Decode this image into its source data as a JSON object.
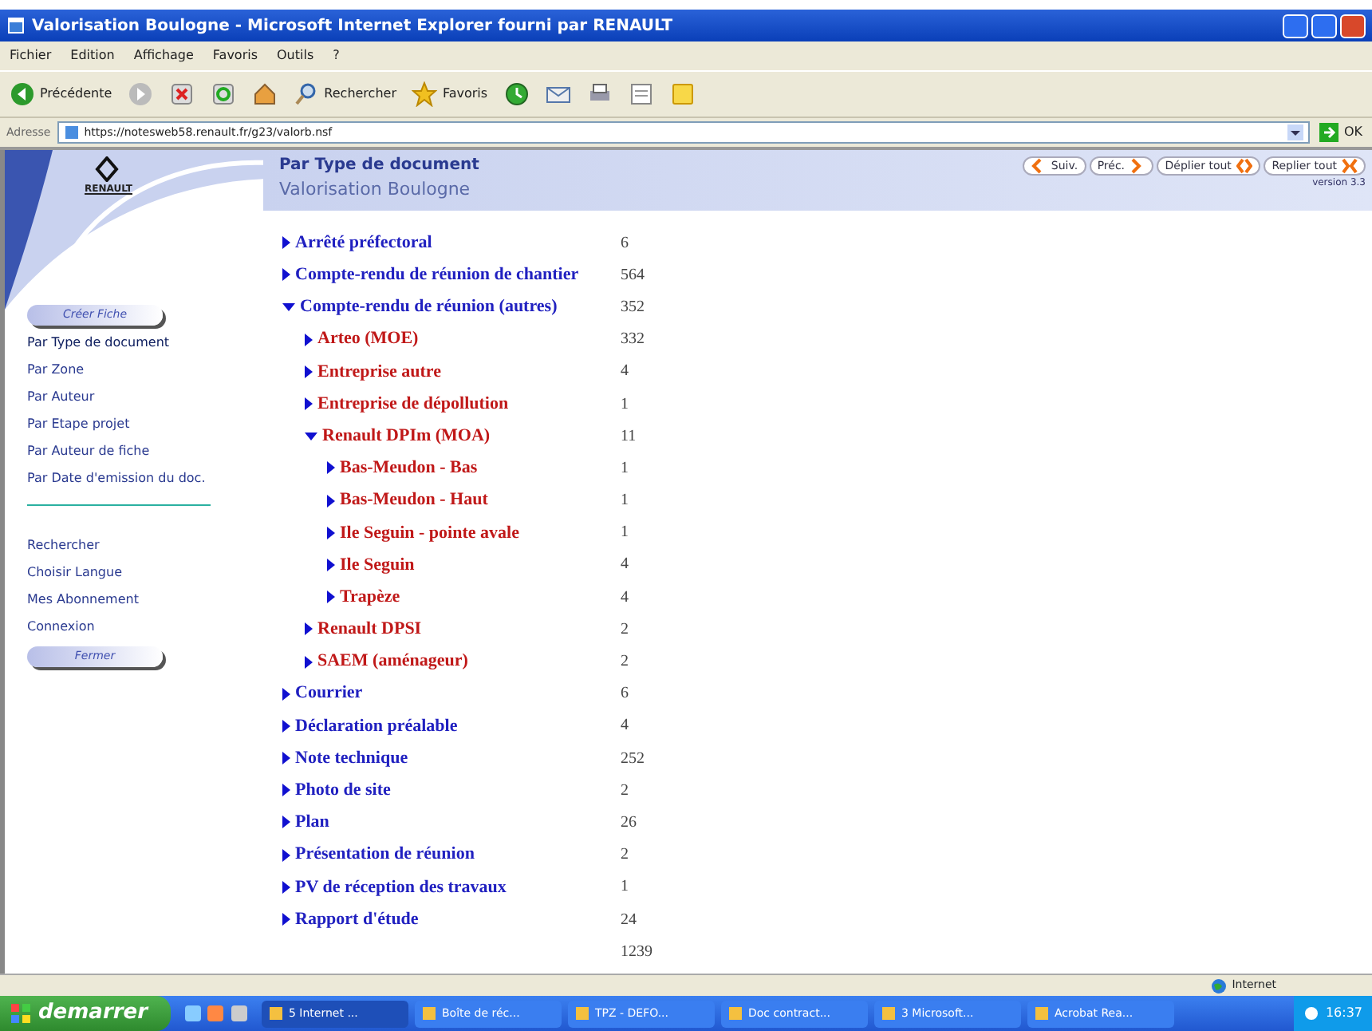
{
  "window": {
    "title": "Valorisation Boulogne - Microsoft Internet Explorer fourni par RENAULT"
  },
  "menu": [
    "Fichier",
    "Edition",
    "Affichage",
    "Favoris",
    "Outils",
    "?"
  ],
  "toolbar": [
    {
      "kind": "back",
      "label": "Précédente"
    },
    {
      "kind": "forward"
    },
    {
      "kind": "stop"
    },
    {
      "kind": "refresh"
    },
    {
      "kind": "home"
    },
    {
      "kind": "search",
      "label": "Rechercher"
    },
    {
      "kind": "favorites",
      "label": "Favoris"
    },
    {
      "kind": "history"
    },
    {
      "kind": "mail"
    },
    {
      "kind": "print"
    },
    {
      "kind": "edit"
    },
    {
      "kind": "note"
    }
  ],
  "address": {
    "label": "Adresse",
    "value": "https://notesweb58.renault.fr/g23/valorb.nsf",
    "go": "OK"
  },
  "sidebar": {
    "logo": "RENAULT",
    "create_button": "Créer Fiche",
    "views": [
      {
        "label": "Par Type de document",
        "selected": true
      },
      {
        "label": "Par Zone",
        "selected": false
      },
      {
        "label": "Par Auteur",
        "selected": false
      },
      {
        "label": "Par Etape projet",
        "selected": false
      },
      {
        "label": "Par Auteur de fiche",
        "selected": false
      },
      {
        "label": "Par Date d'emission du doc.",
        "selected": false
      }
    ],
    "actions": [
      "Rechercher",
      "Choisir Langue",
      "Mes Abonnement",
      "Connexion"
    ],
    "close_button": "Fermer"
  },
  "header": {
    "title": "Par Type de document",
    "subtitle": "Valorisation Boulogne",
    "nav_buttons": [
      {
        "kind": "next",
        "label": "Suiv."
      },
      {
        "kind": "prev",
        "label": "Préc."
      },
      {
        "kind": "expand",
        "label": "Déplier tout"
      },
      {
        "kind": "collapse",
        "label": "Replier tout"
      }
    ],
    "version": "version 3.3"
  },
  "tree": [
    {
      "label": "Arrêté préfectoral",
      "count": "6",
      "expanded": false
    },
    {
      "label": "Compte-rendu de réunion de chantier",
      "count": "564",
      "expanded": false
    },
    {
      "label": "Compte-rendu de réunion (autres)",
      "count": "352",
      "expanded": true,
      "children": [
        {
          "label": "Arteo (MOE)",
          "count": "332",
          "expanded": false
        },
        {
          "label": "Entreprise autre",
          "count": "4",
          "expanded": false
        },
        {
          "label": "Entreprise de dépollution",
          "count": "1",
          "expanded": false
        },
        {
          "label": "Renault DPIm (MOA)",
          "count": "11",
          "expanded": true,
          "children": [
            {
              "label": "Bas-Meudon - Bas",
              "count": "1",
              "expanded": false
            },
            {
              "label": "Bas-Meudon - Haut",
              "count": "1",
              "expanded": false
            },
            {
              "label": "Ile Seguin - pointe avale",
              "count": "1",
              "expanded": false
            },
            {
              "label": "Ile Seguin",
              "count": "4",
              "expanded": false
            },
            {
              "label": "Trapèze",
              "count": "4",
              "expanded": false
            }
          ]
        },
        {
          "label": "Renault DPSI",
          "count": "2",
          "expanded": false
        },
        {
          "label": "SAEM (aménageur)",
          "count": "2",
          "expanded": false
        }
      ]
    },
    {
      "label": "Courrier",
      "count": "6",
      "expanded": false
    },
    {
      "label": "Déclaration préalable",
      "count": "4",
      "expanded": false
    },
    {
      "label": "Note technique",
      "count": "252",
      "expanded": false
    },
    {
      "label": "Photo de site",
      "count": "2",
      "expanded": false
    },
    {
      "label": "Plan",
      "count": "26",
      "expanded": false
    },
    {
      "label": "Présentation de réunion",
      "count": "2",
      "expanded": false
    },
    {
      "label": "PV de réception des travaux",
      "count": "1",
      "expanded": false
    },
    {
      "label": "Rapport d'étude",
      "count": "24",
      "expanded": false
    }
  ],
  "total": "1239",
  "status_bar": {
    "zone": "Internet"
  },
  "taskbar": {
    "start": "demarrer",
    "tasks": [
      {
        "label": "5 Internet ...",
        "selected": true
      },
      {
        "label": "Boîte de réc...",
        "selected": false
      },
      {
        "label": "TPZ - DEFO...",
        "selected": false
      },
      {
        "label": "Doc contract...",
        "selected": false
      },
      {
        "label": "3 Microsoft...",
        "selected": false
      },
      {
        "label": "Acrobat Rea...",
        "selected": false
      }
    ],
    "clock": "16:37"
  }
}
